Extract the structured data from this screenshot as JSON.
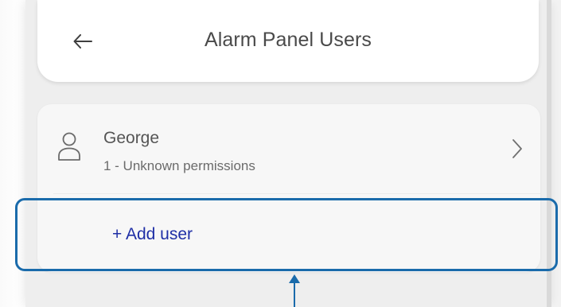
{
  "header": {
    "back_icon": "arrow-left-icon",
    "title": "Alarm Panel Users"
  },
  "users": [
    {
      "icon": "user-outline-icon",
      "name": "George",
      "permissions": "1 - Unknown permissions",
      "action_icon": "chevron-right-icon"
    }
  ],
  "add_user": {
    "label": "+ Add user",
    "color": "#1f2fa6"
  },
  "annotation": {
    "highlight_color": "#1a6bab",
    "arrow_icon": "arrow-up-icon"
  }
}
